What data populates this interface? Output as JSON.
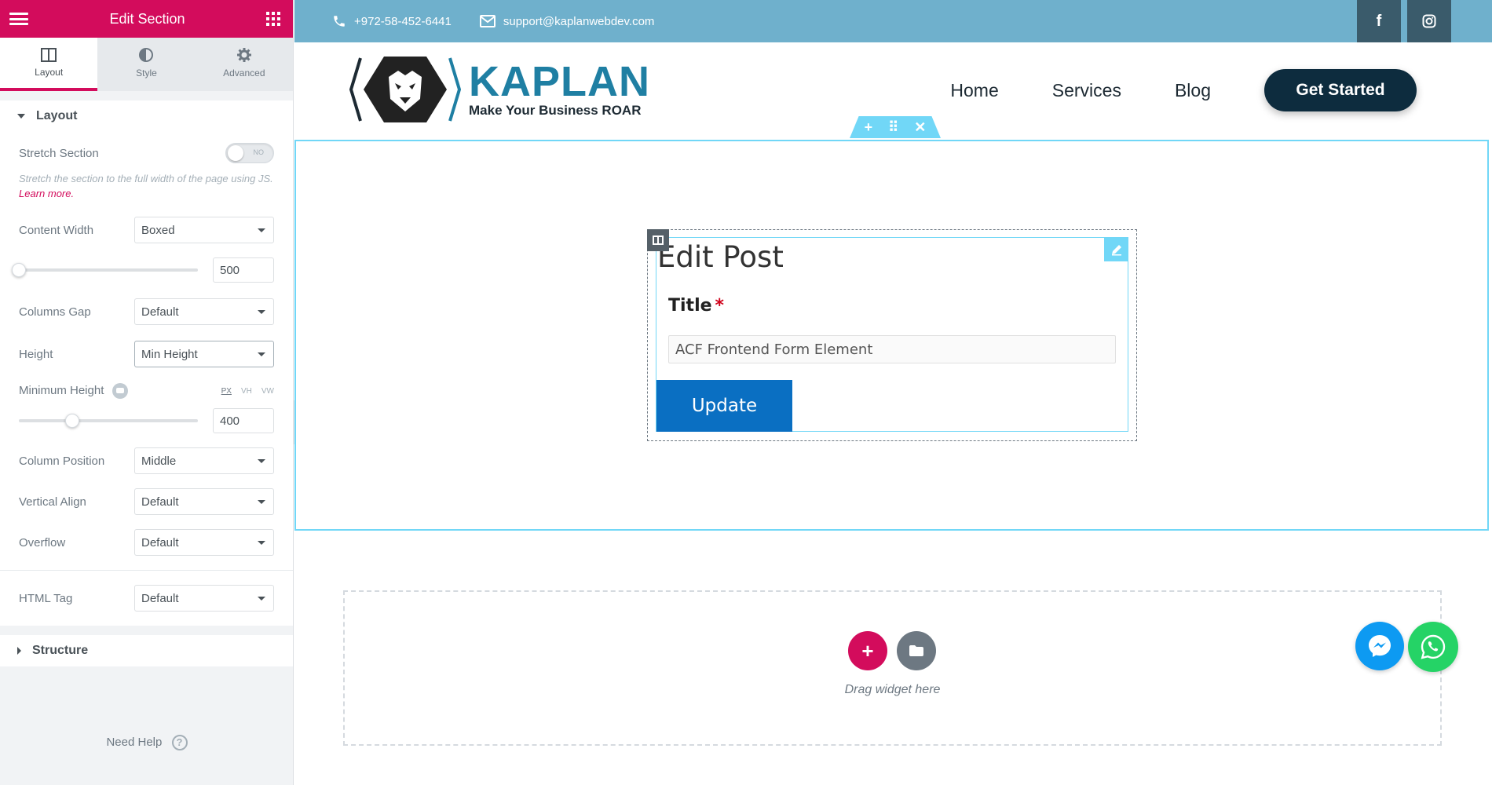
{
  "panel": {
    "title": "Edit Section",
    "tabs": [
      {
        "label": "Layout",
        "icon": "layout-columns-icon",
        "active": true
      },
      {
        "label": "Style",
        "icon": "half-circle-icon",
        "active": false
      },
      {
        "label": "Advanced",
        "icon": "gear-icon",
        "active": false
      }
    ],
    "layout_section": {
      "title": "Layout",
      "stretch_section": {
        "label": "Stretch Section",
        "toggle_text": "NO",
        "value": false
      },
      "stretch_desc": "Stretch the section to the full width of the page using JS.",
      "learn_more": "Learn more.",
      "content_width": {
        "label": "Content Width",
        "value": "Boxed"
      },
      "content_width_value": "500",
      "content_width_fraction": 0.0,
      "columns_gap": {
        "label": "Columns Gap",
        "value": "Default"
      },
      "height": {
        "label": "Height",
        "value": "Min Height"
      },
      "minimum_height": {
        "label": "Minimum Height",
        "units": [
          "PX",
          "VH",
          "VW"
        ],
        "active_unit": "PX",
        "value": "400",
        "fraction": 0.3
      },
      "column_position": {
        "label": "Column Position",
        "value": "Middle"
      },
      "vertical_align": {
        "label": "Vertical Align",
        "value": "Default"
      },
      "overflow": {
        "label": "Overflow",
        "value": "Default"
      },
      "html_tag": {
        "label": "HTML Tag",
        "value": "Default"
      }
    },
    "structure_section": {
      "title": "Structure"
    },
    "need_help": "Need Help"
  },
  "site": {
    "phone": "+972-58-452-6441",
    "email": "support@kaplanwebdev.com",
    "social": [
      {
        "icon": "facebook-icon",
        "glyph": "f"
      },
      {
        "icon": "instagram-icon",
        "glyph": ""
      }
    ],
    "logo_name": "KAPLAN",
    "logo_tagline": "Make Your Business ROAR",
    "nav": [
      "Home",
      "Services",
      "Blog"
    ],
    "cta": "Get Started"
  },
  "section_handle": {
    "add": "+",
    "move": "⠿",
    "close": "✕"
  },
  "form": {
    "title": "Edit Post",
    "field_label": "Title",
    "required_mark": "*",
    "field_value": "ACF Frontend Form Element",
    "submit": "Update"
  },
  "dropzone": {
    "add": "+",
    "text": "Drag widget here"
  },
  "colors": {
    "brand": "#d30c5c",
    "topbar": "#6fb0cc",
    "accent_outline": "#71d7f7",
    "cta": "#0d2c3e",
    "update_button": "#0a6fc2"
  }
}
